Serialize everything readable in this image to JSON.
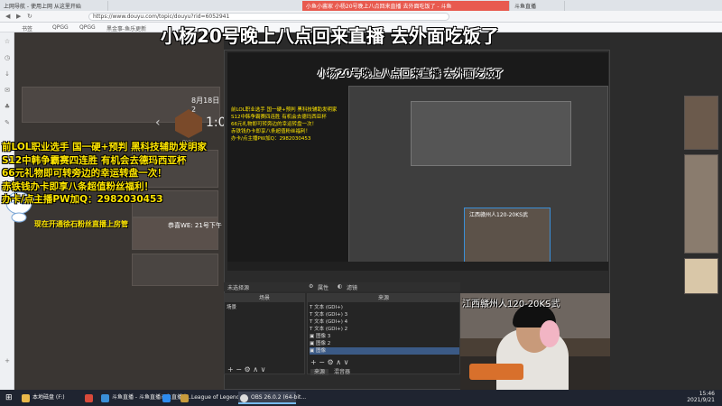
{
  "browser": {
    "tabs": [
      "上网导航 - 使用上网 从这里开始",
      "小鱼小酱家 小杨20号晚上八点回来直播 去外面吃饭了 - 斗鱼",
      "斗鱼直播"
    ],
    "url": "https://www.douyu.com/topic/douyu?rid=6052941",
    "bookmarks": [
      "书签",
      "QPGG",
      "QPGG",
      "黑金事-鱼乐更新"
    ]
  },
  "overlay": {
    "main_title": "小杨20号晚上八点回来直播  去外面吃饭了",
    "yellow_lines": [
      "前LOL职业选手 国一硬+预判 黑科技辅助发明家",
      "S12中韩争霸赛四连胜 有机会去德玛西亚杯",
      "66元礼物即可转旁边的幸运转盘一次！",
      "赤铁钱办卡即享八条超值粉丝福利！",
      "办卡/点主播PW加Q：2982030453"
    ],
    "yellow_small": "现在开通徐石粉丝直播上房管",
    "webcam_label": "江西赣州人120-20KS武"
  },
  "obs": {
    "nested_title": "小杨20号晚上八点回来直播  去外面吃饭了",
    "nested_yellow": "前LOL职业选手 国一硬+预判 黑科技辅助发明家\nS12中韩争霸赛四连胜 有机会去德玛西亚杯\n66元礼物即可转旁边的幸运转盘一次！\n赤铁钱办卡即享八条超值粉丝福利！\n办卡/点主播PW加Q：2982030453",
    "nested_cam_label": "江西赣州人120-20KS武",
    "toolbar_label": "未选择源",
    "toolbar_props": "属性",
    "toolbar_filters": "滤镜",
    "scenes_header": "场景",
    "scenes": [
      "场景"
    ],
    "sources_header": "来源",
    "sources": [
      "文本 (GDI+)",
      "文本 (GDI+) 3",
      "文本 (GDI+) 4",
      "文本 (GDI+) 2",
      "图像 3",
      "图像 2",
      "图像"
    ],
    "mixer_tabs": [
      "来源",
      "混音器"
    ],
    "tool_symbols": "+ − ⚙ ∧ ∨"
  },
  "douyu_page": {
    "date_label": "8月18日 2",
    "badge": "DYX",
    "card_title": "恭喜WE: 21号下午",
    "timer": "1:0"
  },
  "taskbar": {
    "items": [
      "本地磁盘 (F:)",
      "",
      "斗鱼直播 - 斗鱼直播斗鱼直播中...",
      "",
      "League of Legends",
      "OBS 26.0.2 (64-bit..."
    ],
    "clock_time": "15:46",
    "clock_date": "2021/9/21"
  }
}
